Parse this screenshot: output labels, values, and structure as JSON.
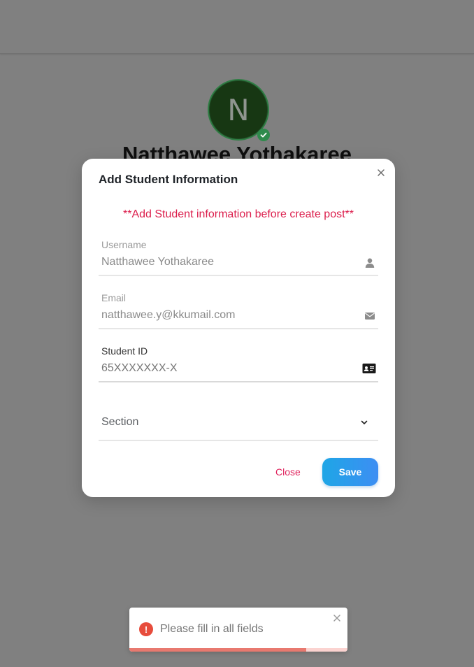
{
  "profile": {
    "avatar_letter": "N",
    "name": "Natthawee Yothakaree"
  },
  "modal": {
    "title": "Add Student Information",
    "warning": "**Add Student information before create post**",
    "fields": {
      "username": {
        "label": "Username",
        "value": "Natthawee Yothakaree",
        "icon": "user-icon"
      },
      "email": {
        "label": "Email",
        "value": "natthawee.y@kkumail.com",
        "icon": "envelope-icon"
      },
      "student_id": {
        "label": "Student ID",
        "placeholder": "65XXXXXXX-X",
        "icon": "id-card-icon"
      },
      "section": {
        "placeholder": "Section",
        "icon": "chevron-down-icon"
      }
    },
    "close_label": "Close",
    "save_label": "Save"
  },
  "toast": {
    "message": "Please fill in all fields",
    "icon": "error-icon",
    "progress": 0.81
  },
  "colors": {
    "overlay": "#808080",
    "warning": "#dc1f4d",
    "close_text": "#e0245e",
    "save_gradient_start": "#1ea6e6",
    "save_gradient_end": "#3d8ef3",
    "toast_error": "#e74c3c",
    "verified": "#2f8a4c"
  }
}
